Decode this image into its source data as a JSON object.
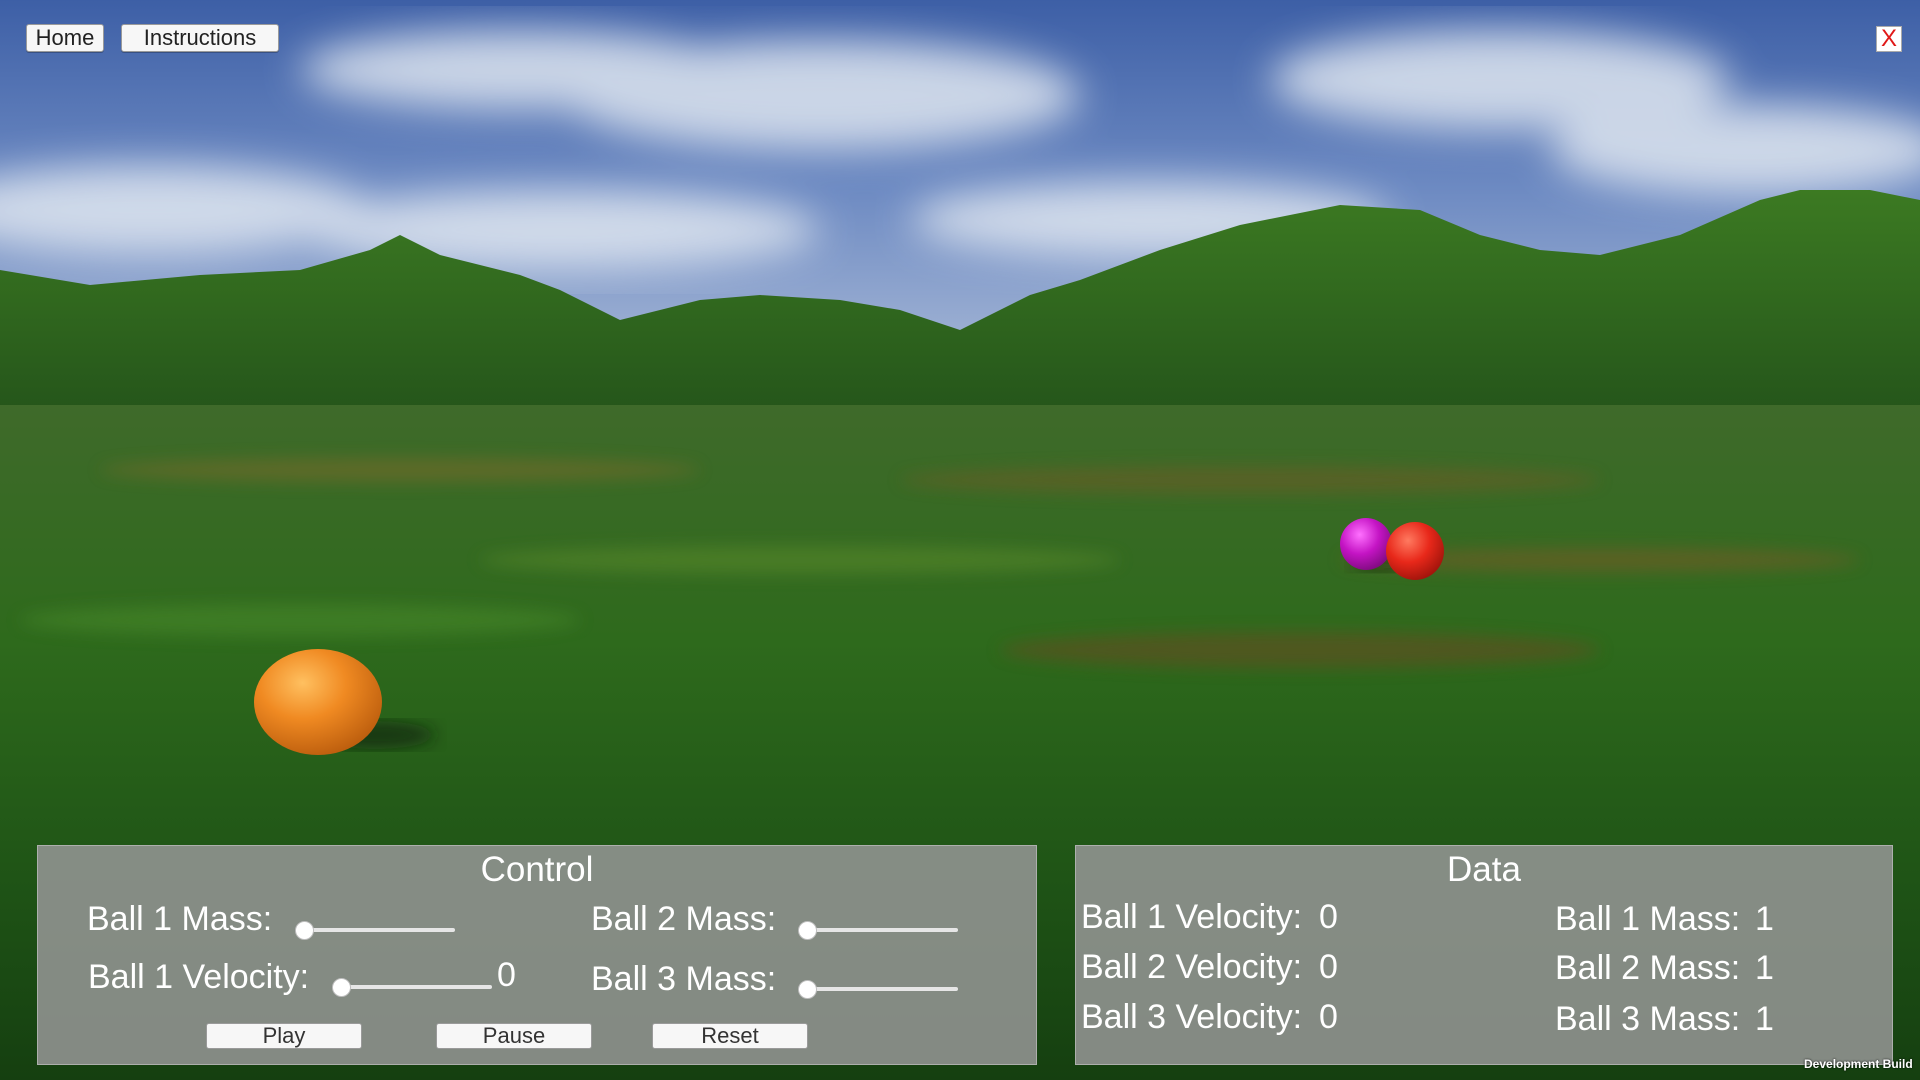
{
  "top_bar": {
    "home_label": "Home",
    "instructions_label": "Instructions",
    "close_label": "X"
  },
  "control": {
    "title": "Control",
    "ball1_mass_label": "Ball 1 Mass:",
    "ball2_mass_label": "Ball 2 Mass:",
    "ball1_velocity_label": "Ball 1 Velocity:",
    "ball1_velocity_value": "0",
    "ball3_mass_label": "Ball 3 Mass:",
    "sliders": {
      "ball1_mass_fraction": 0,
      "ball2_mass_fraction": 0,
      "ball1_velocity_fraction": 0,
      "ball3_mass_fraction": 0
    },
    "play_label": "Play",
    "pause_label": "Pause",
    "reset_label": "Reset"
  },
  "data": {
    "title": "Data",
    "velocities": [
      {
        "label": "Ball 1 Velocity:",
        "value": "0"
      },
      {
        "label": "Ball 2 Velocity:",
        "value": "0"
      },
      {
        "label": "Ball 3 Velocity:",
        "value": "0"
      }
    ],
    "masses": [
      {
        "label": "Ball 1 Mass:",
        "value": "1"
      },
      {
        "label": "Ball 2 Mass:",
        "value": "1"
      },
      {
        "label": "Ball 3 Mass:",
        "value": "1"
      }
    ]
  },
  "footer": {
    "build_label": "Development Build"
  },
  "scene": {
    "ball_colors": {
      "ball_orange": "#f08a22",
      "ball_magenta": "#c414c4",
      "ball_red": "#e8281a"
    },
    "sky_color": "#5a78b4",
    "ground_color": "#2f6b1e"
  }
}
